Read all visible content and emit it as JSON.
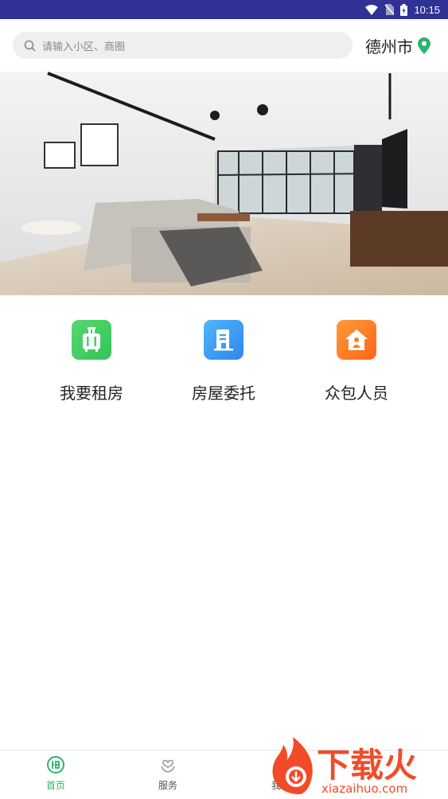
{
  "status_bar": {
    "time": "10:15"
  },
  "search": {
    "placeholder": "请输入小区、商圈"
  },
  "location": {
    "city": "德州市"
  },
  "menu": {
    "items": [
      {
        "label": "我要租房",
        "icon": "luggage-icon",
        "color": "#4cd166"
      },
      {
        "label": "房屋委托",
        "icon": "building-icon",
        "color": "#3d9df0"
      },
      {
        "label": "众包人员",
        "icon": "house-person-icon",
        "color": "#ff7a1f"
      }
    ]
  },
  "tabbar": {
    "items": [
      {
        "label": "首页",
        "icon": "home-rent-icon",
        "active": true
      },
      {
        "label": "服务",
        "icon": "service-icon",
        "active": false
      },
      {
        "label": "我的",
        "icon": "profile-icon",
        "active": false
      }
    ]
  },
  "watermark": {
    "title": "下载火",
    "domain": "xiazaihuo.com"
  },
  "colors": {
    "accent": "#2db36b",
    "status_bar": "#2f3195",
    "watermark": "#f24b2a"
  }
}
